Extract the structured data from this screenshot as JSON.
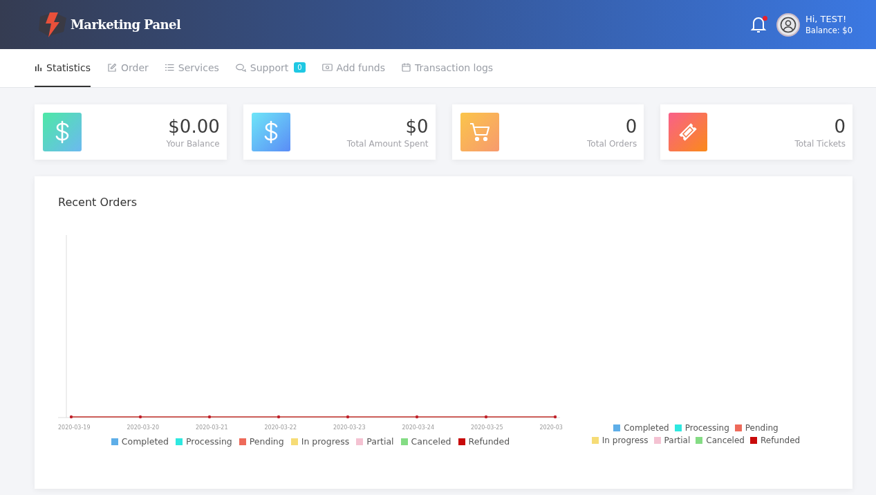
{
  "header": {
    "logo_text": "Marketing Panel",
    "notification": {
      "unread": true
    },
    "greeting": "Hi, TEST!",
    "balance": "Balance: $0"
  },
  "tabs": [
    {
      "label": "Statistics",
      "selected": true
    },
    {
      "label": "Order",
      "selected": false
    },
    {
      "label": "Services",
      "selected": false
    },
    {
      "label": "Support",
      "badge": "0",
      "selected": false
    },
    {
      "label": "Add funds",
      "selected": false
    },
    {
      "label": "Transaction logs",
      "selected": false
    }
  ],
  "stats": [
    {
      "value": "$0.00",
      "label": "Your Balance",
      "kind": "dollar"
    },
    {
      "value": "$0",
      "label": "Total Amount Spent",
      "kind": "dollar"
    },
    {
      "value": "0",
      "label": "Total Orders",
      "kind": "cart"
    },
    {
      "value": "0",
      "label": "Total Tickets",
      "kind": "ticket"
    }
  ],
  "recent_orders": {
    "title": "Recent Orders",
    "line_chart": {
      "x_labels": [
        "2020-03-19",
        "2020-03-20",
        "2020-03-21",
        "2020-03-22",
        "2020-03-23",
        "2020-03-24",
        "2020-03-25",
        "2020-03"
      ],
      "legend": [
        {
          "name": "Completed",
          "color": "#5eaee8"
        },
        {
          "name": "Processing",
          "color": "#2ee8e0"
        },
        {
          "name": "Pending",
          "color": "#ee6a5a"
        },
        {
          "name": "In progress",
          "color": "#f6dc76"
        },
        {
          "name": "Partial",
          "color": "#f4c2d2"
        },
        {
          "name": "Canceled",
          "color": "#84dc84"
        },
        {
          "name": "Refunded",
          "color": "#c80a0a"
        }
      ]
    },
    "pie_legend": [
      {
        "name": "Completed",
        "color": "#5eaee8"
      },
      {
        "name": "Processing",
        "color": "#2ee8e0"
      },
      {
        "name": "Pending",
        "color": "#ee6a5a"
      },
      {
        "name": "In progress",
        "color": "#f6dc76"
      },
      {
        "name": "Partial",
        "color": "#f4c2d2"
      },
      {
        "name": "Canceled",
        "color": "#84dc84"
      },
      {
        "name": "Refunded",
        "color": "#c80a0a"
      }
    ]
  }
}
